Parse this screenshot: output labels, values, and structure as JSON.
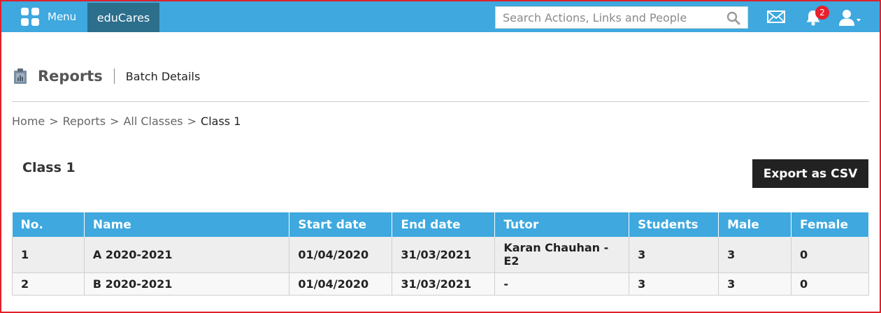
{
  "topbar": {
    "menu_label": "Menu",
    "brand": "eduCares",
    "search_placeholder": "Search Actions, Links and People",
    "notification_count": "2",
    "icons": [
      "grid-icon",
      "search-icon",
      "mail-icon",
      "bell-icon",
      "user-icon"
    ],
    "colors": {
      "bar": "#3ea8df",
      "brand": "#2c6f8c",
      "badge": "#e8212d"
    }
  },
  "header": {
    "title": "Reports",
    "subtitle": "Batch Details"
  },
  "breadcrumb": {
    "items": [
      "Home",
      "Reports",
      "All Classes"
    ],
    "current": "Class 1",
    "separator": ">"
  },
  "main": {
    "class_title": "Class 1",
    "export_label": "Export as CSV"
  },
  "table": {
    "headers": [
      "No.",
      "Name",
      "Start date",
      "End date",
      "Tutor",
      "Students",
      "Male",
      "Female"
    ],
    "rows": [
      [
        "1",
        "A 2020-2021",
        "01/04/2020",
        "31/03/2021",
        "Karan Chauhan - E2",
        "3",
        "3",
        "0"
      ],
      [
        "2",
        "B 2020-2021",
        "01/04/2020",
        "31/03/2021",
        "-",
        "3",
        "3",
        "0"
      ]
    ]
  }
}
